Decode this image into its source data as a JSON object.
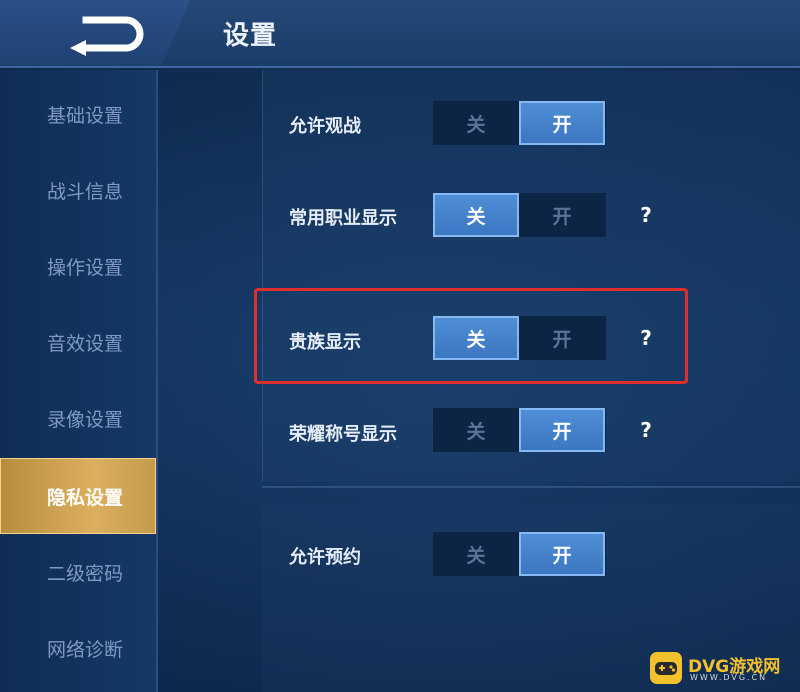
{
  "header": {
    "title": "设置"
  },
  "sidebar": {
    "items": [
      {
        "label": "基础设置"
      },
      {
        "label": "战斗信息"
      },
      {
        "label": "操作设置"
      },
      {
        "label": "音效设置"
      },
      {
        "label": "录像设置"
      },
      {
        "label": "隐私设置",
        "active": true
      },
      {
        "label": "二级密码"
      },
      {
        "label": "网络诊断"
      }
    ]
  },
  "settings": [
    {
      "label": "允许观战",
      "off": "关",
      "on": "开",
      "state": "on"
    },
    {
      "label": "常用职业显示",
      "off": "关",
      "on": "开",
      "state": "off",
      "help": "?"
    },
    {
      "label": "贵族显示",
      "off": "关",
      "on": "开",
      "state": "off",
      "help": "?"
    },
    {
      "label": "荣耀称号显示",
      "off": "关",
      "on": "开",
      "state": "on",
      "help": "?"
    },
    {
      "label": "允许预约",
      "off": "关",
      "on": "开",
      "state": "on"
    }
  ],
  "colors": {
    "active_tab": "#d0a452",
    "toggle_on": "#4582cc",
    "highlight": "#e02e2e",
    "watermark": "#f3c12c"
  },
  "watermark": {
    "text": "DVG游戏网",
    "sub": "WWW.DVG.CN"
  }
}
